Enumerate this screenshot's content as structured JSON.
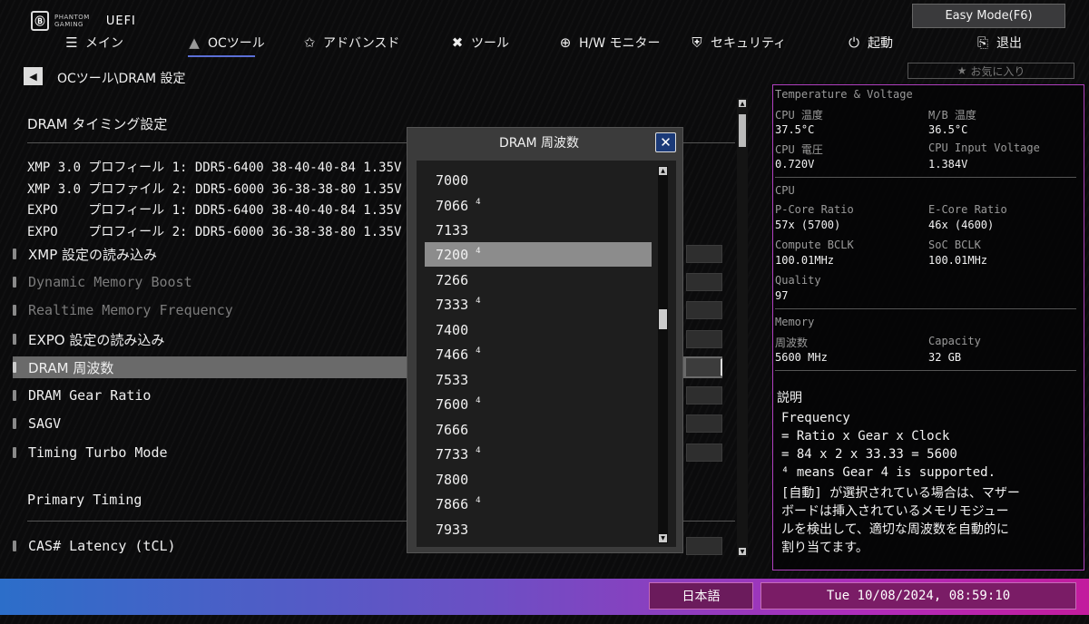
{
  "header": {
    "brand_line1": "PHANTOM",
    "brand_line2": "GAMING",
    "uefi": "UEFI",
    "easy_mode": "Easy Mode(F6)",
    "favorites": "お気に入り"
  },
  "nav": [
    {
      "label": "メイン",
      "icon": "list-icon"
    },
    {
      "label": "OCツール",
      "icon": "rocket-icon"
    },
    {
      "label": "アドバンスド",
      "icon": "star-icon"
    },
    {
      "label": "ツール",
      "icon": "tools-icon"
    },
    {
      "label": "H/W モニター",
      "icon": "crosshair-icon"
    },
    {
      "label": "セキュリティ",
      "icon": "shield-icon"
    },
    {
      "label": "起動",
      "icon": "power-icon"
    },
    {
      "label": "退出",
      "icon": "exit-icon"
    }
  ],
  "breadcrumb": "OCツール\\DRAM 設定",
  "main": {
    "section_title": "DRAM タイミング設定",
    "profiles": [
      "XMP 3.0 プロフィール 1: DDR5-6400 38-40-40-84 1.35V",
      "XMP 3.0 プロファイル 2: DDR5-6000 36-38-38-80 1.35V",
      "EXPO    プロフィール 1: DDR5-6400 38-40-40-84 1.35V",
      "EXPO    プロフィール 2: DDR5-6000 36-38-38-80 1.35V"
    ],
    "items": [
      "XMP 設定の読み込み",
      "Dynamic Memory Boost",
      "Realtime Memory Frequency",
      "EXPO 設定の読み込み",
      "DRAM 周波数",
      "DRAM Gear Ratio",
      "SAGV",
      "Timing Turbo Mode"
    ],
    "primary_timing": "Primary Timing",
    "cas_latency": "CAS# Latency (tCL)"
  },
  "info": {
    "temp_voltage_title": "Temperature & Voltage",
    "cpu_temp_label": "CPU 温度",
    "cpu_temp": "37.5°C",
    "mb_temp_label": "M/B 温度",
    "mb_temp": "36.5°C",
    "cpu_voltage_label": "CPU 電圧",
    "cpu_voltage": "0.720V",
    "cpu_input_voltage_label": "CPU Input Voltage",
    "cpu_input_voltage": "1.384V",
    "cpu_title": "CPU",
    "pcore_label": "P-Core Ratio",
    "pcore": "57x (5700)",
    "ecore_label": "E-Core Ratio",
    "ecore": "46x (4600)",
    "compute_bclk_label": "Compute BCLK",
    "compute_bclk": "100.01MHz",
    "soc_bclk_label": "SoC BCLK",
    "soc_bclk": "100.01MHz",
    "quality_label": "Quality",
    "quality": "97",
    "memory_title": "Memory",
    "freq_label": "周波数",
    "freq": "5600 MHz",
    "capacity_label": "Capacity",
    "capacity": "32 GB",
    "desc_title": "説明",
    "desc_lines": [
      "Frequency",
      "= Ratio x Gear x Clock",
      "= 84 x 2 x 33.33 = 5600",
      "⁴ means Gear 4 is supported.",
      "[自動] が選択されている場合は、マザー",
      "ボードは挿入されているメモリモジュー",
      "ルを検出して、適切な周波数を自動的に",
      "割り当てます。"
    ]
  },
  "modal": {
    "title": "DRAM 周波数",
    "options": [
      {
        "value": "7000",
        "gear4": ""
      },
      {
        "value": "7066",
        "gear4": "4"
      },
      {
        "value": "7133",
        "gear4": ""
      },
      {
        "value": "7200",
        "gear4": "4"
      },
      {
        "value": "7266",
        "gear4": ""
      },
      {
        "value": "7333",
        "gear4": "4"
      },
      {
        "value": "7400",
        "gear4": ""
      },
      {
        "value": "7466",
        "gear4": "4"
      },
      {
        "value": "7533",
        "gear4": ""
      },
      {
        "value": "7600",
        "gear4": "4"
      },
      {
        "value": "7666",
        "gear4": ""
      },
      {
        "value": "7733",
        "gear4": "4"
      },
      {
        "value": "7800",
        "gear4": ""
      },
      {
        "value": "7866",
        "gear4": "4"
      },
      {
        "value": "7933",
        "gear4": ""
      }
    ],
    "selected": "7200"
  },
  "footer": {
    "language": "日本語",
    "datetime": "Tue 10/08/2024, 08:59:10"
  },
  "colors": {
    "accent": "#5b6fd6",
    "panel_border": "#b03fbf",
    "close_button": "#1b3a78"
  }
}
